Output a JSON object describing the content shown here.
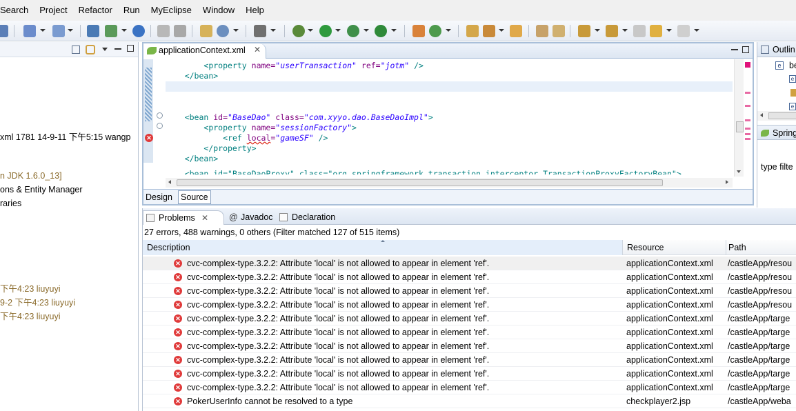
{
  "menubar": [
    "Search",
    "Project",
    "Refactor",
    "Run",
    "MyEclipse",
    "Window",
    "Help"
  ],
  "left_panel": {
    "history_line": "xml 1781  14-9-11 下午5:15  wangp",
    "jdk_line": "n JDK 1.6.0_13]",
    "entity_line": "ons & Entity Manager",
    "libraries_line": "raries",
    "commit_lines": [
      "下午4:23  liuyuyi",
      "9-2 下午4:23  liuyuyi",
      "下午4:23  liuyuyi"
    ]
  },
  "editor": {
    "tab_label": "applicationContext.xml",
    "bottom_tabs": [
      "Design",
      "Source"
    ],
    "lines": {
      "l1": {
        "open": "<property ",
        "name_attr": "name=",
        "name_val": "\"userTransaction\"",
        "ref_attr": " ref=",
        "ref_val": "\"jotm\"",
        "close": " />"
      },
      "l2": "</bean>",
      "l4": {
        "open": "<bean ",
        "id_attr": "id=",
        "id_val": "\"BaseDao\"",
        "class_attr": " class=",
        "class_val": "\"com.xyyo.dao.BaseDaoImpl\"",
        "close": ">"
      },
      "l5": {
        "open": "<property ",
        "name_attr": "name=",
        "name_val": "\"sessionFactory\"",
        "close": ">"
      },
      "l6": {
        "open": "<ref ",
        "local_attr": "local",
        "eq": "=",
        "local_val": "\"gameSF\"",
        "close": " />"
      },
      "l7": "</property>",
      "l8": "</bean>",
      "l9": "<bean id=\"BaseDaoProxy\" class=\"org.springframework.transaction.interceptor.TransactionProxyFactoryBean\">"
    }
  },
  "problems": {
    "tabs": [
      "Problems",
      "Javadoc",
      "Declaration"
    ],
    "summary": "27 errors, 488 warnings, 0 others (Filter matched 127 of 515 items)",
    "columns": [
      "Description",
      "Resource",
      "Path"
    ],
    "rows": [
      {
        "description": "cvc-complex-type.3.2.2: Attribute 'local' is not allowed to appear in element 'ref'.",
        "resource": "applicationContext.xml",
        "path": "/castleApp/resou"
      },
      {
        "description": "cvc-complex-type.3.2.2: Attribute 'local' is not allowed to appear in element 'ref'.",
        "resource": "applicationContext.xml",
        "path": "/castleApp/resou"
      },
      {
        "description": "cvc-complex-type.3.2.2: Attribute 'local' is not allowed to appear in element 'ref'.",
        "resource": "applicationContext.xml",
        "path": "/castleApp/resou"
      },
      {
        "description": "cvc-complex-type.3.2.2: Attribute 'local' is not allowed to appear in element 'ref'.",
        "resource": "applicationContext.xml",
        "path": "/castleApp/resou"
      },
      {
        "description": "cvc-complex-type.3.2.2: Attribute 'local' is not allowed to appear in element 'ref'.",
        "resource": "applicationContext.xml",
        "path": "/castleApp/targe"
      },
      {
        "description": "cvc-complex-type.3.2.2: Attribute 'local' is not allowed to appear in element 'ref'.",
        "resource": "applicationContext.xml",
        "path": "/castleApp/targe"
      },
      {
        "description": "cvc-complex-type.3.2.2: Attribute 'local' is not allowed to appear in element 'ref'.",
        "resource": "applicationContext.xml",
        "path": "/castleApp/targe"
      },
      {
        "description": "cvc-complex-type.3.2.2: Attribute 'local' is not allowed to appear in element 'ref'.",
        "resource": "applicationContext.xml",
        "path": "/castleApp/targe"
      },
      {
        "description": "cvc-complex-type.3.2.2: Attribute 'local' is not allowed to appear in element 'ref'.",
        "resource": "applicationContext.xml",
        "path": "/castleApp/targe"
      },
      {
        "description": "cvc-complex-type.3.2.2: Attribute 'local' is not allowed to appear in element 'ref'.",
        "resource": "applicationContext.xml",
        "path": "/castleApp/targe"
      },
      {
        "description": "PokerUserInfo cannot be resolved to a type",
        "resource": "checkplayer2.jsp",
        "path": "/castleApp/weba"
      }
    ]
  },
  "right_panel": {
    "outline_title": "Outlin",
    "outline_items": [
      "be",
      "e",
      "",
      "e"
    ],
    "spring_title": "Spring",
    "filter_text": "type filte"
  },
  "colors": {
    "error": "#e03a3a",
    "xml_tag": "#007f7f",
    "xml_attr": "#7f007f",
    "xml_string": "#2a00ff",
    "history_text": "#8a6a2a"
  }
}
